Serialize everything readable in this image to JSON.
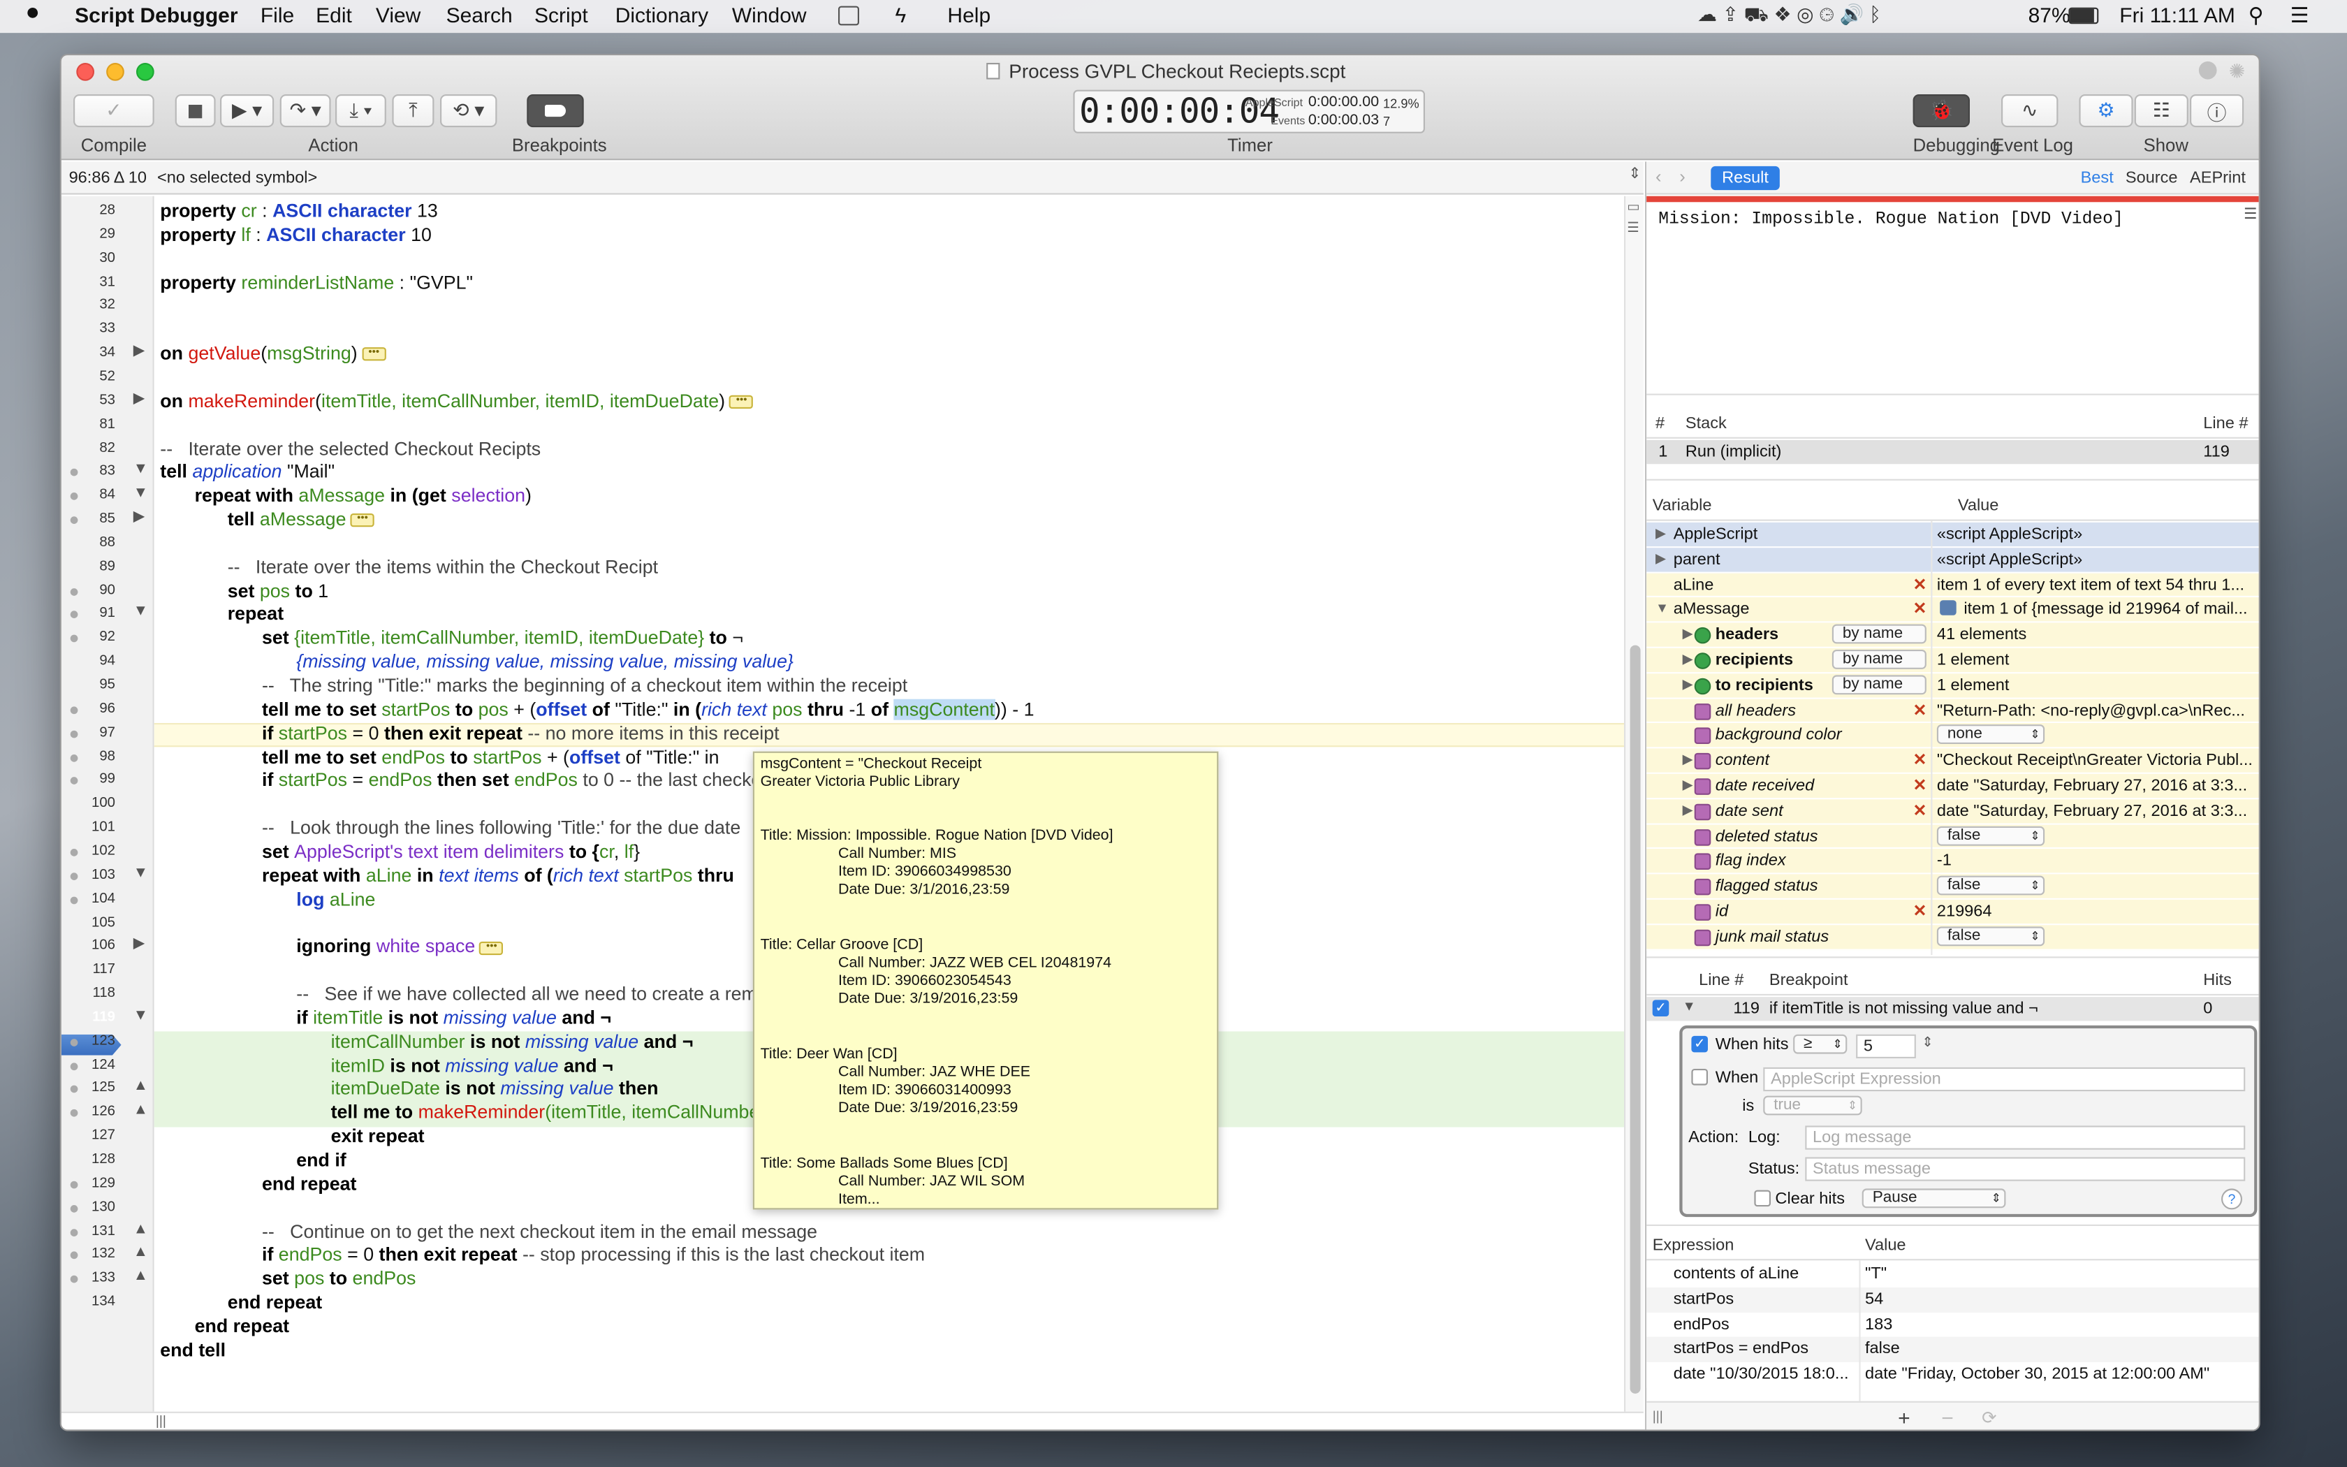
{
  "menubar": {
    "app": "Script Debugger",
    "items": [
      "File",
      "Edit",
      "View",
      "Search",
      "Script",
      "Dictionary",
      "Window",
      "Help"
    ],
    "battery": "87%",
    "clock": "Fri 11:11 AM"
  },
  "window": {
    "title": "Process GVPL Checkout Reciepts.scpt"
  },
  "toolbar": {
    "compile": "Compile",
    "action": "Action",
    "breakpoints": "Breakpoints",
    "timer_label": "Timer",
    "timer_value": "0:00:00:04",
    "applescript_label": "AppleScript",
    "applescript_time": "0:00:00.00",
    "applescript_pct": "12.9%",
    "events_label": "Events",
    "events_time": "0:00:00.03",
    "events_count": "7",
    "debugging": "Debugging",
    "event_log": "Event Log",
    "show": "Show"
  },
  "editor": {
    "position": "96:86 Δ 10",
    "symbol": "<no selected symbol>",
    "current_line": "119"
  },
  "code": {
    "l28a": "property ",
    "l28b": "cr",
    "l28c": " : ",
    "l28d": "ASCII character",
    "l28e": " 13",
    "l29a": "property ",
    "l29b": "lf",
    "l29c": " : ",
    "l29d": "ASCII character",
    "l29e": " 10",
    "l31a": "property ",
    "l31b": "reminderListName",
    "l31c": " : \"GVPL\"",
    "l34a": "on ",
    "l34b": "getValue",
    "l34c": "(",
    "l34d": "msgString",
    "l34e": ")",
    "l53a": "on ",
    "l53b": "makeReminder",
    "l53c": "(",
    "l53d": "itemTitle, itemCallNumber, itemID, itemDueDate",
    "l53e": ")",
    "l82": "--   Iterate over the selected Checkout Recipts",
    "l83a": "tell ",
    "l83b": "application",
    "l83c": " \"Mail\"",
    "l84a": "repeat with ",
    "l84b": "aMessage",
    "l84c": " in ",
    "l84d": "(get ",
    "l84e": "selection",
    "l84f": ")",
    "l85a": "tell ",
    "l85b": "aMessage",
    "l89": "--   Iterate over the items within the Checkout Recipt",
    "l90a": "set ",
    "l90b": "pos",
    "l90c": " to ",
    "l90d": "1",
    "l91": "repeat",
    "l92a": "set ",
    "l92b": "{itemTitle, itemCallNumber, itemID, itemDueDate}",
    "l92c": " to ",
    "l92d": "¬",
    "l93": "{missing value, missing value, missing value, missing value}",
    "l95": "--   The string \"Title:\" marks the beginning of a checkout item within the receipt",
    "l96a": "tell me to set ",
    "l96b": "startPos",
    "l96c": " to ",
    "l96d": "pos",
    "l96e": " + (",
    "l96f": "offset",
    "l96g": " of ",
    "l96h": "\"Title:\"",
    "l96i": " in (",
    "l96j": "rich text",
    "l96k": " pos ",
    "l96l": "thru ",
    "l96m": "-1 ",
    "l96n": "of ",
    "l96o": "msgContent",
    "l96p": ")) - 1",
    "l97a": "if ",
    "l97b": "startPos",
    "l97c": " = 0 ",
    "l97d": "then exit repeat",
    "l97e": " -- no more items in this receipt",
    "l98a": "tell me to set ",
    "l98b": "endPos",
    "l98c": " to ",
    "l98d": "startPos",
    "l98e": " + (",
    "l98f": "offset",
    "l98g": " of \"Title:\" in",
    "l99a": "if ",
    "l99b": "startPos",
    "l99c": " = ",
    "l99d": "endPos",
    "l99e": " then set ",
    "l99f": "endPos",
    "l99g": " to 0 -- the last checkout item",
    "l101": "--   Look through the lines following 'Title:' for the due date",
    "l102a": "set ",
    "l102b": "AppleScript's text item delimiters",
    "l102c": " to {",
    "l102d": "cr",
    "l102e": ", ",
    "l102f": "lf",
    "l102g": "}",
    "l103a": "repeat with ",
    "l103b": "aLine",
    "l103c": " in ",
    "l103d": "text items",
    "l103e": " of (",
    "l103f": "rich text",
    "l103g": " startPos ",
    "l103h": "thru",
    "l104a": "log ",
    "l104b": "aLine",
    "l106a": "ignoring ",
    "l106b": "white space",
    "l118": "--   See if we have collected all we need to create a reminder for this item",
    "l119a": "if ",
    "l119b": "itemTitle",
    "l119c": " is not ",
    "l119d": "missing value",
    "l119e": " and ¬",
    "l120a": "itemCallNumber",
    "l120b": " is not ",
    "l120c": "missing value",
    "l120d": " and ¬",
    "l121a": "itemID",
    "l121b": " is not ",
    "l121c": "missing value",
    "l121d": " and ¬",
    "l122a": "itemDueDate",
    "l122b": " is not ",
    "l122c": "missing value",
    "l122d": " then",
    "l123a": "tell me to ",
    "l123b": "makeReminder",
    "l123c": "(itemTitle, itemCallNumber, itemID, itemDueDate)",
    "l124": "exit repeat",
    "l125": "end if",
    "l126": "end repeat",
    "l128": "--   Continue on to get the next checkout item in the email message",
    "l129a": "if ",
    "l129b": "endPos",
    "l129c": " = 0 ",
    "l129d": "then exit repeat",
    "l129e": " -- stop processing if this is the last checkout item",
    "l130a": "set ",
    "l130b": "pos",
    "l130c": " to ",
    "l130d": "endPos",
    "l131": "end repeat",
    "l132": "end repeat",
    "l133": "end tell"
  },
  "line_numbers": [
    "28",
    "29",
    "30",
    "31",
    "32",
    "33",
    "34",
    "52",
    "53",
    "81",
    "82",
    "83",
    "84",
    "85",
    "88",
    "89",
    "90",
    "91",
    "92",
    "94",
    "95",
    "96",
    "97",
    "98",
    "99",
    "100",
    "101",
    "102",
    "103",
    "104",
    "105",
    "106",
    "117",
    "118",
    "119",
    "123",
    "124",
    "125",
    "126",
    "127",
    "128",
    "129",
    "130",
    "131",
    "132",
    "133",
    "134"
  ],
  "tooltip": {
    "l1": "msgContent = \"Checkout Receipt",
    "l2": "Greater Victoria Public Library",
    "t1": "Title: Mission: Impossible. Rogue Nation [DVD Video]",
    "t1c": "Call Number: MIS",
    "t1i": "Item ID: 39066034998530",
    "t1d": "Date Due: 3/1/2016,23:59",
    "t2": "Title: Cellar Groove [CD]",
    "t2c": "Call Number: JAZZ WEB CEL I20481974",
    "t2i": "Item ID: 39066023054543",
    "t2d": "Date Due: 3/19/2016,23:59",
    "t3": "Title: Deer Wan [CD]",
    "t3c": "Call Number: JAZ WHE DEE",
    "t3i": "Item ID: 39066031400993",
    "t3d": "Date Due: 3/19/2016,23:59",
    "t4": "Title: Some Ballads Some Blues [CD]",
    "t4c": "Call Number: JAZ WIL SOM",
    "t4i": "Item..."
  },
  "result": {
    "tab": "Result",
    "best": "Best",
    "source": "Source",
    "aeprint": "AEPrint",
    "text": "Mission: Impossible. Rogue Nation [DVD Video]"
  },
  "stack": {
    "h_num": "#",
    "h_stack": "Stack",
    "h_line": "Line #",
    "row_num": "1",
    "row_name": "Run (implicit)",
    "row_line": "119"
  },
  "variables": {
    "h_var": "Variable",
    "h_val": "Value",
    "rows": [
      {
        "name": "AppleScript",
        "value": "«script AppleScript»"
      },
      {
        "name": "parent",
        "value": "«script AppleScript»"
      },
      {
        "name": "aLine",
        "value": "item 1 of every text item of text 54 thru 1..."
      },
      {
        "name": "aMessage",
        "value": "item 1 of {message id 219964 of mail..."
      },
      {
        "name": "headers",
        "mode": "by name",
        "value": "41 elements"
      },
      {
        "name": "recipients",
        "mode": "by name",
        "value": "1 element"
      },
      {
        "name": "to recipients",
        "mode": "by name",
        "value": "1 element"
      },
      {
        "name": "all headers",
        "value": "\"Return-Path: <no-reply@gvpl.ca>\\nRec..."
      },
      {
        "name": "background color",
        "value": "none"
      },
      {
        "name": "content",
        "value": "\"Checkout Receipt\\nGreater Victoria Publ..."
      },
      {
        "name": "date received",
        "value": "date \"Saturday, February 27, 2016 at 3:3..."
      },
      {
        "name": "date sent",
        "value": "date \"Saturday, February 27, 2016 at 3:3..."
      },
      {
        "name": "deleted status",
        "value": "false"
      },
      {
        "name": "flag index",
        "value": "-1"
      },
      {
        "name": "flagged status",
        "value": "false"
      },
      {
        "name": "id",
        "value": "219964"
      },
      {
        "name": "junk mail status",
        "value": "false"
      }
    ]
  },
  "breakpoints": {
    "h_line": "Line #",
    "h_bp": "Breakpoint",
    "h_hits": "Hits",
    "row_line": "119",
    "row_text": "if itemTitle is not missing value and ¬",
    "row_hits": "0",
    "when_hits": "When hits",
    "op": "≥",
    "count": "5",
    "when": "When",
    "when_placeholder": "AppleScript Expression",
    "is": "is",
    "is_value": "true",
    "action": "Action:",
    "log": "Log:",
    "log_placeholder": "Log message",
    "status": "Status:",
    "status_placeholder": "Status message",
    "clear_hits": "Clear hits",
    "pause": "Pause",
    "help": "?"
  },
  "expressions": {
    "h_expr": "Expression",
    "h_val": "Value",
    "rows": [
      {
        "expr": "contents of aLine",
        "value": "\"T\""
      },
      {
        "expr": "startPos",
        "value": "54"
      },
      {
        "expr": "endPos",
        "value": "183"
      },
      {
        "expr": "startPos = endPos",
        "value": "false"
      },
      {
        "expr": "date \"10/30/2015 18:0...",
        "value": "date \"Friday, October 30, 2015 at 12:00:00 AM\""
      }
    ]
  },
  "colors": {
    "accent": "#2f7fe6",
    "current_line_bg": "#e6f5df",
    "highlight_line_bg": "#fffbe0",
    "tooltip_bg": "#fefec8",
    "error_red": "#e4443a"
  }
}
